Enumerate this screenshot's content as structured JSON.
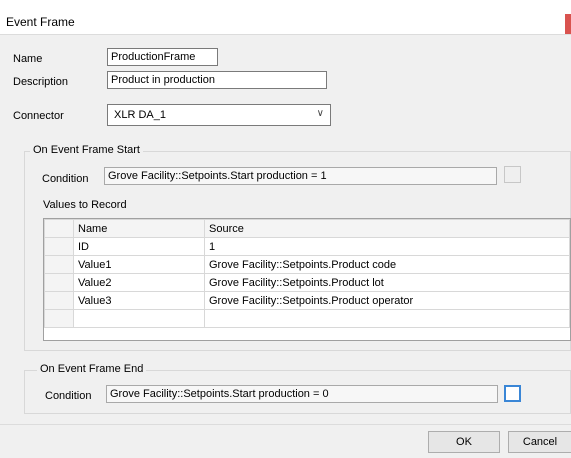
{
  "window": {
    "title": "Event Frame"
  },
  "form": {
    "name_label": "Name",
    "name_value": "ProductionFrame",
    "description_label": "Description",
    "description_value": "Product in production",
    "connector_label": "Connector",
    "connector_value": "XLR DA_1"
  },
  "start_group": {
    "legend": "On Event Frame Start",
    "condition_label": "Condition",
    "condition_value": "Grove Facility::Setpoints.Start production = 1",
    "values_label": "Values to Record",
    "columns": [
      "Name",
      "Source"
    ],
    "rows": [
      {
        "name": "ID",
        "source": "1"
      },
      {
        "name": "Value1",
        "source": "Grove Facility::Setpoints.Product code"
      },
      {
        "name": "Value2",
        "source": "Grove Facility::Setpoints.Product lot"
      },
      {
        "name": "Value3",
        "source": "Grove Facility::Setpoints.Product operator"
      },
      {
        "name": "",
        "source": ""
      }
    ]
  },
  "end_group": {
    "legend": "On Event Frame End",
    "condition_label": "Condition",
    "condition_value": "Grove Facility::Setpoints.Start production = 0"
  },
  "buttons": {
    "ok": "OK",
    "cancel": "Cancel"
  },
  "colors": {
    "accent": "#3a86d6",
    "close": "#d9534f"
  }
}
